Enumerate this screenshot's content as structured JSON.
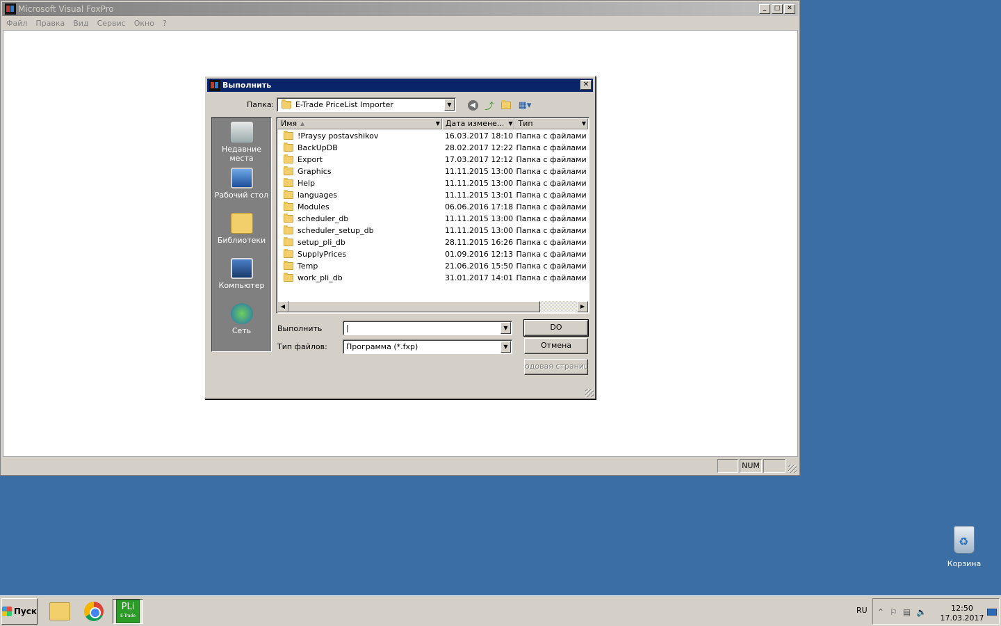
{
  "main_window": {
    "title": "Microsoft Visual FoxPro",
    "menu": [
      "Файл",
      "Правка",
      "Вид",
      "Сервис",
      "Окно",
      "?"
    ],
    "status_num": "NUM"
  },
  "dialog": {
    "title": "Выполнить",
    "folder_label": "Папка:",
    "folder_value": "E-Trade PriceList Importer",
    "places": [
      "Недавние места",
      "Рабочий стол",
      "Библиотеки",
      "Компьютер",
      "Сеть"
    ],
    "columns": [
      "Имя",
      "Дата измене...",
      "Тип"
    ],
    "files": [
      {
        "name": "!Praysy postavshikov",
        "date": "16.03.2017 18:10",
        "type": "Папка с файлами"
      },
      {
        "name": "BackUpDB",
        "date": "28.02.2017 12:22",
        "type": "Папка с файлами"
      },
      {
        "name": "Export",
        "date": "17.03.2017 12:12",
        "type": "Папка с файлами"
      },
      {
        "name": "Graphics",
        "date": "11.11.2015 13:00",
        "type": "Папка с файлами"
      },
      {
        "name": "Help",
        "date": "11.11.2015 13:00",
        "type": "Папка с файлами"
      },
      {
        "name": "languages",
        "date": "11.11.2015 13:01",
        "type": "Папка с файлами"
      },
      {
        "name": "Modules",
        "date": "06.06.2016 17:18",
        "type": "Папка с файлами"
      },
      {
        "name": "scheduler_db",
        "date": "11.11.2015 13:00",
        "type": "Папка с файлами"
      },
      {
        "name": "scheduler_setup_db",
        "date": "11.11.2015 13:00",
        "type": "Папка с файлами"
      },
      {
        "name": "setup_pli_db",
        "date": "28.11.2015 16:26",
        "type": "Папка с файлами"
      },
      {
        "name": "SupplyPrices",
        "date": "01.09.2016 12:13",
        "type": "Папка с файлами"
      },
      {
        "name": "Temp",
        "date": "21.06.2016 15:50",
        "type": "Папка с файлами"
      },
      {
        "name": "work_pli_db",
        "date": "31.01.2017 14:01",
        "type": "Папка с файлами"
      }
    ],
    "run_label": "Выполнить",
    "run_value": "|",
    "filetype_label": "Тип файлов:",
    "filetype_value": "Программа (*.fxp)",
    "btn_do": "DO",
    "btn_cancel": "Отмена",
    "btn_codepage": "одовая страница"
  },
  "desktop": {
    "recycle_bin": "Корзина"
  },
  "taskbar": {
    "start": "Пуск",
    "lang": "RU",
    "time": "12:50",
    "date": "17.03.2017",
    "pli_top": "PLi",
    "pli_bottom": "E-Trade"
  }
}
